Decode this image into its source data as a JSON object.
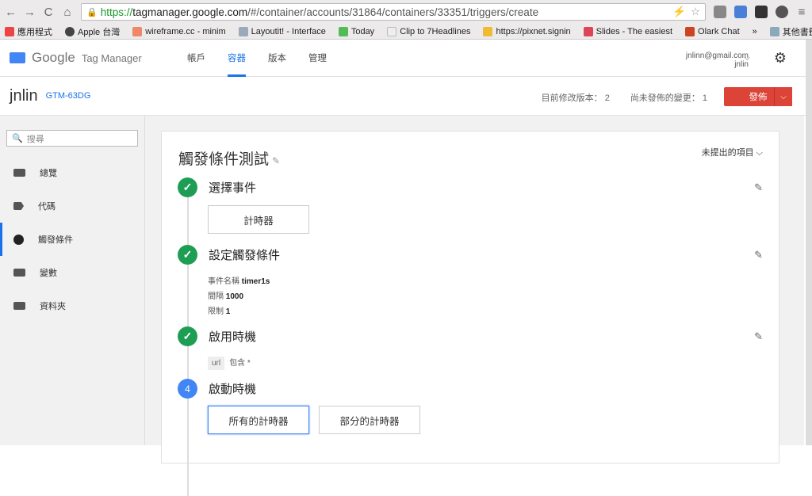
{
  "browser": {
    "url_scheme": "https://",
    "url_host": "tagmanager.google.com",
    "url_path": "/#/container/accounts/31864/containers/33351/triggers/create",
    "bookmarks": [
      "應用程式",
      "Apple 台灣",
      "wireframe.cc - minim",
      "Layoutit! - Interface",
      "Today",
      "Clip to 7Headlines",
      "https://pixnet.signin",
      "Slides - The easiest",
      "Olark Chat"
    ],
    "bookmarks_more": "»",
    "other_bookmarks": "其他書籤"
  },
  "app": {
    "logo_google": "Google",
    "logo_product": "Tag Manager",
    "nav": [
      "帳戶",
      "容器",
      "版本",
      "管理"
    ],
    "active_nav": 1,
    "email": "jnlinn@gmail.com",
    "username": "jnlin"
  },
  "container": {
    "name": "jnlin",
    "id": "GTM-63DG",
    "version_label": "目前修改版本：",
    "version": "2",
    "unpublished_label": "尚未發佈的變更：",
    "unpublished": "1",
    "publish": "發佈"
  },
  "sidebar": {
    "search_placeholder": "搜尋",
    "items": [
      "總覽",
      "代碼",
      "觸發條件",
      "變數",
      "資料夾"
    ],
    "active": 2
  },
  "trigger": {
    "title": "觸發條件測試",
    "unsubmitted": "未提出的項目",
    "step1": {
      "title": "選擇事件",
      "choice": "計時器"
    },
    "step2": {
      "title": "設定觸發條件",
      "event_label": "事件名稱",
      "event_value": "timer1s",
      "interval_label": "間隔",
      "interval_value": "1000",
      "limit_label": "限制",
      "limit_value": "1"
    },
    "step3": {
      "title": "啟用時機",
      "var": "url",
      "op": "包含",
      "val": "*"
    },
    "step4": {
      "num": "4",
      "title": "啟動時機",
      "options": [
        "所有的計時器",
        "部分的計時器"
      ]
    }
  }
}
